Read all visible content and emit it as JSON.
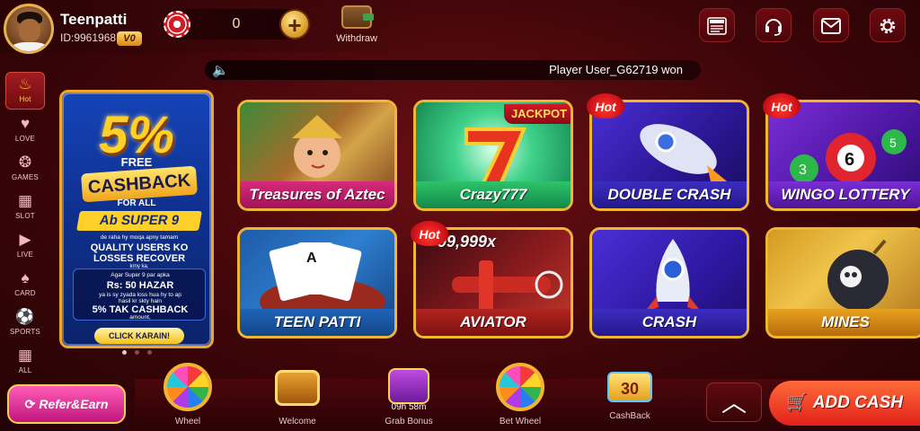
{
  "header": {
    "username": "Teenpatti",
    "user_id": "ID:9961968",
    "vip_level": "V0",
    "balance": "0",
    "plus_label": "+",
    "withdraw_label": "Withdraw",
    "icons": [
      "news-icon",
      "support-icon",
      "mail-icon",
      "settings-icon"
    ],
    "news_label": "NEWS"
  },
  "marquee": {
    "text": "Player User_G62719 won"
  },
  "sidebar": {
    "items": [
      {
        "label": "Hot",
        "icon": "flame-icon"
      },
      {
        "label": "LOVE",
        "icon": "heart-icon"
      },
      {
        "label": "GAMES",
        "icon": "dice-icon"
      },
      {
        "label": "SLOT",
        "icon": "slot-icon"
      },
      {
        "label": "LIVE",
        "icon": "live-icon"
      },
      {
        "label": "CARD",
        "icon": "card-icon"
      },
      {
        "label": "SPORTS",
        "icon": "sports-icon"
      },
      {
        "label": "ALL",
        "icon": "grid-icon"
      }
    ]
  },
  "banner": {
    "percent": "5%",
    "free": "FREE",
    "cashback": "CASHBACK",
    "for_all": "FOR ALL",
    "super": "Ab SUPER 9",
    "line1": "de raha hy moqa apny tamam",
    "line2": "QUALITY USERS KO",
    "line3": "LOSSES RECOVER",
    "line4": "krny ka.",
    "box1": "Agar Super 9 par apka",
    "box2": "Rs: 50 HAZAR",
    "box3": "ya is sy zyada loss hua hy to ap",
    "box4": "hasil kr skty hain",
    "box5": "5% TAK CASHBACK",
    "box6": "amount,",
    "click": "CLICK KARAIN!"
  },
  "games": [
    {
      "label": "Treasures of Aztec",
      "hot": false,
      "badge": ""
    },
    {
      "label": "Crazy777",
      "hot": false,
      "badge": "JACKPOT"
    },
    {
      "label": "DOUBLE CRASH",
      "hot": true,
      "badge": ""
    },
    {
      "label": "WINGO LOTTERY",
      "hot": true,
      "badge": ""
    },
    {
      "label": "TEEN PATTI",
      "hot": false,
      "badge": ""
    },
    {
      "label": "AVIATOR",
      "hot": true,
      "badge": "99,999x"
    },
    {
      "label": "CRASH",
      "hot": false,
      "badge": ""
    },
    {
      "label": "MINES",
      "hot": false,
      "badge": ""
    }
  ],
  "hot_label": "Hot",
  "bottom": {
    "refer": "Refer&Earn",
    "items": [
      {
        "label": "Wheel",
        "timer": ""
      },
      {
        "label": "Welcome",
        "timer": ""
      },
      {
        "label": "Grab Bonus",
        "timer": "09h 58m"
      },
      {
        "label": "Bet Wheel",
        "timer": ""
      },
      {
        "label": "CashBack",
        "timer": ""
      }
    ],
    "cashback_value": "30",
    "up_arrow": "︿",
    "add_cash": "ADD CASH"
  },
  "colors": {
    "accent_gold": "#f0b632",
    "background_red": "#3d0508",
    "hot_red": "#d5141b"
  }
}
